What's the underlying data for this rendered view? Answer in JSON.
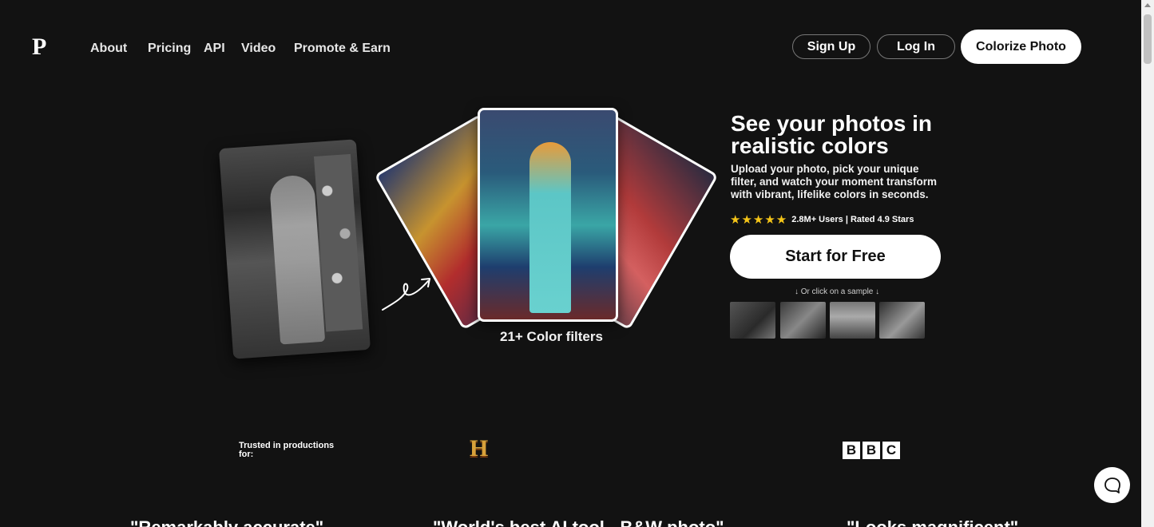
{
  "header": {
    "logo": "P",
    "nav": [
      "About",
      "Pricing",
      "API",
      "Video",
      "Promote & Earn"
    ],
    "sign_up": "Sign Up",
    "log_in": "Log In",
    "colorize": "Colorize Photo"
  },
  "hero": {
    "headline": "See your photos in realistic colors",
    "subtext": "Upload your photo, pick your unique filter, and watch your moment transform with vibrant, lifelike colors in seconds.",
    "stars": "★★★★★",
    "rating": "2.8M+ Users | Rated 4.9 Stars",
    "cta": "Start for Free",
    "sample_hint": "↓ Or click on a sample ↓",
    "filters_caption": "21+ Color filters"
  },
  "trusted": {
    "label": "Trusted in productions for:",
    "history_logo": "H",
    "bbc_letters": [
      "B",
      "B",
      "C"
    ]
  },
  "quotes": [
    "\"Remarkably accurate\"",
    "\"World's best AI tool - B&W photo\"",
    "\"Looks magnificent\""
  ],
  "colors": {
    "background": "#121212",
    "accent_star": "#f5c518",
    "button_bg": "#ffffff"
  }
}
